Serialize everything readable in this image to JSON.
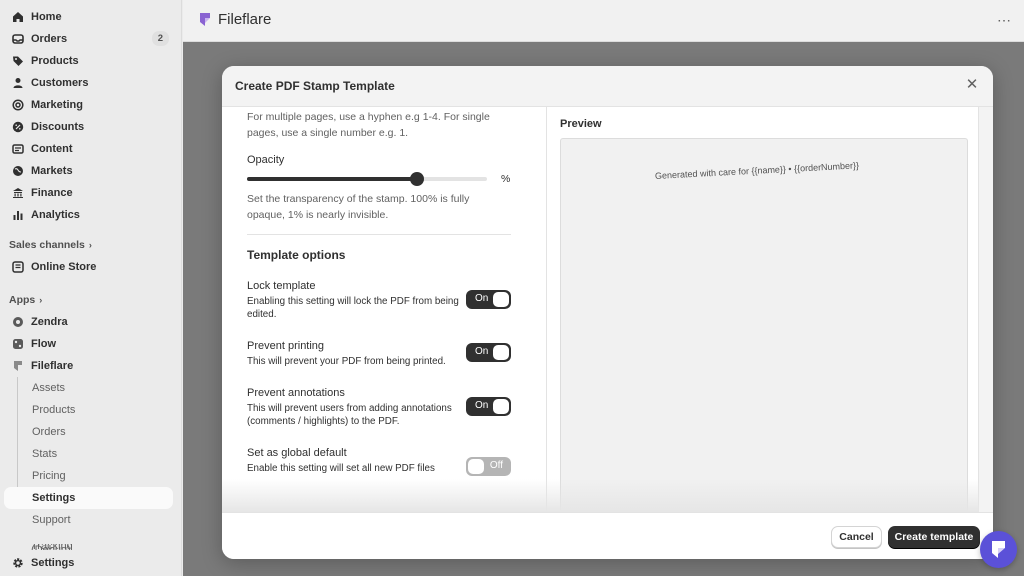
{
  "sidebar": {
    "items": [
      {
        "label": "Home",
        "icon": "home-icon"
      },
      {
        "label": "Orders",
        "icon": "inbox-icon",
        "badge": "2"
      },
      {
        "label": "Products",
        "icon": "tag-icon"
      },
      {
        "label": "Customers",
        "icon": "person-icon"
      },
      {
        "label": "Marketing",
        "icon": "target-icon"
      },
      {
        "label": "Discounts",
        "icon": "discount-icon"
      },
      {
        "label": "Content",
        "icon": "content-icon"
      },
      {
        "label": "Markets",
        "icon": "globe-icon"
      },
      {
        "label": "Finance",
        "icon": "bank-icon"
      },
      {
        "label": "Analytics",
        "icon": "bar-chart-icon"
      }
    ],
    "sales_channels_label": "Sales channels",
    "online_store_label": "Online Store",
    "apps_label": "Apps",
    "apps": [
      {
        "label": "Zendra",
        "icon": "zendra-icon"
      },
      {
        "label": "Flow",
        "icon": "flow-icon"
      },
      {
        "label": "Fileflare",
        "icon": "fileflare-icon"
      }
    ],
    "fileflare_sub": [
      "Assets",
      "Products",
      "Orders",
      "Stats",
      "Pricing",
      "Settings",
      "Support"
    ],
    "cutoff_label": "Tracking (Debug)",
    "settings_label": "Settings"
  },
  "topbar": {
    "title": "Fileflare",
    "more": "⋯"
  },
  "modal": {
    "title": "Create PDF Stamp Template",
    "close": "✕",
    "pages_help_1": "For multiple pages, use a hyphen e.g 1-4. For single",
    "pages_help_2": "pages, use a single number e.g. 1.",
    "opacity_label": "Opacity",
    "opacity_value": 0.71,
    "opacity_unit": "%",
    "opacity_help_1": "Set the transparency of the stamp. 100% is fully",
    "opacity_help_2": "opaque, 1% is nearly invisible.",
    "template_options_title": "Template options",
    "options": [
      {
        "title": "Lock template",
        "desc": "Enabling this setting will lock the PDF from being edited.",
        "state": "On",
        "on": true
      },
      {
        "title": "Prevent printing",
        "desc": "This will prevent your PDF from being printed.",
        "state": "On",
        "on": true
      },
      {
        "title": "Prevent annotations",
        "desc": "This will prevent users from adding annotations (comments / highlights) to the PDF.",
        "state": "On",
        "on": true
      },
      {
        "title": "Set as global default",
        "desc": "Enable this setting will set all new PDF files",
        "state": "Off",
        "on": false
      }
    ],
    "preview_title": "Preview",
    "stamp_text": "Generated with care for {{name}} • {{orderNumber}}",
    "cancel_label": "Cancel",
    "create_label": "Create template"
  },
  "colors": {
    "primary": "#303030",
    "fab": "#5b51d8",
    "overlay": "#7a7a7a",
    "fileflare_brand": "#8a63d2"
  }
}
